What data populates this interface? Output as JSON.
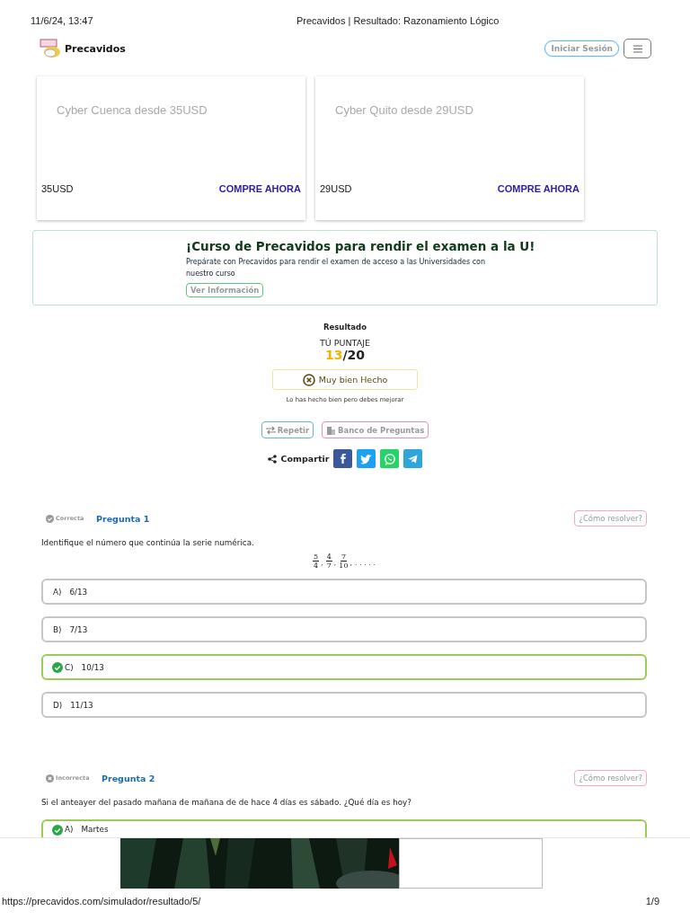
{
  "print_header": {
    "date": "11/6/24, 13:47",
    "title": "Precavidos | Resultado: Razonamiento Lógico"
  },
  "navbar": {
    "brand": "Precavidos",
    "login_button": "Iniciar Sesión"
  },
  "offers": [
    {
      "title": "Cyber Cuenca desde 35USD",
      "price": "35USD",
      "action": "COMPRE AHORA"
    },
    {
      "title": "Cyber Quito desde 29USD",
      "price": "29USD",
      "action": "COMPRE AHORA"
    }
  ],
  "promo": {
    "title": "¡Curso de Precavidos para rendir el examen a la U!",
    "text": "Prepárate con Precavidos para rendir el examen de acceso a las Universidades con nuestro curso",
    "button": "Ver Información"
  },
  "result": {
    "heading": "Resultado",
    "score_label": "TÚ PUNTAJE",
    "score": "13",
    "total": "/20",
    "verdict": "Muy bien Hecho",
    "message": "Lo has hecho bien pero debes mejorar",
    "buttons": [
      {
        "label": "Repetir",
        "kind": "repeat"
      },
      {
        "label": "Banco de Preguntas",
        "kind": "bank"
      }
    ],
    "share_label": "Compartir",
    "share": [
      {
        "kind": "facebook"
      },
      {
        "kind": "twitter"
      },
      {
        "kind": "whatsapp"
      },
      {
        "kind": "telegram"
      }
    ]
  },
  "questions": [
    {
      "kind": "correct",
      "status_label": "Correcta",
      "title": "Pregunta 1",
      "help_button": "¿Cómo resolver?",
      "text": "Identifique el número que continúa la serie numérica.",
      "series": [
        {
          "num": "5",
          "den": "4",
          "after": ","
        },
        {
          "num": "4",
          "den": "7",
          "after": ","
        },
        {
          "num": "7",
          "den": "10",
          "after": ","
        }
      ],
      "series_tail": ". . . . .",
      "options": [
        {
          "letter": "A)",
          "text": "6/13",
          "correct": false
        },
        {
          "letter": "B)",
          "text": "7/13",
          "correct": false
        },
        {
          "letter": "C)",
          "text": "10/13",
          "correct": true
        },
        {
          "letter": "D)",
          "text": "11/13",
          "correct": false
        }
      ]
    },
    {
      "kind": "incorrect",
      "status_label": "Incorrecta",
      "title": "Pregunta 2",
      "help_button": "¿Cómo resolver?",
      "text": "Si el anteayer del pasado mañana de mañana de de hace 4 días es sábado. ¿Qué día es hoy?",
      "options": [
        {
          "letter": "A)",
          "text": "Martes",
          "correct": true
        }
      ]
    }
  ],
  "print_footer": {
    "url": "https://precavidos.com/simulador/resultado/5/",
    "page": "1/9"
  }
}
